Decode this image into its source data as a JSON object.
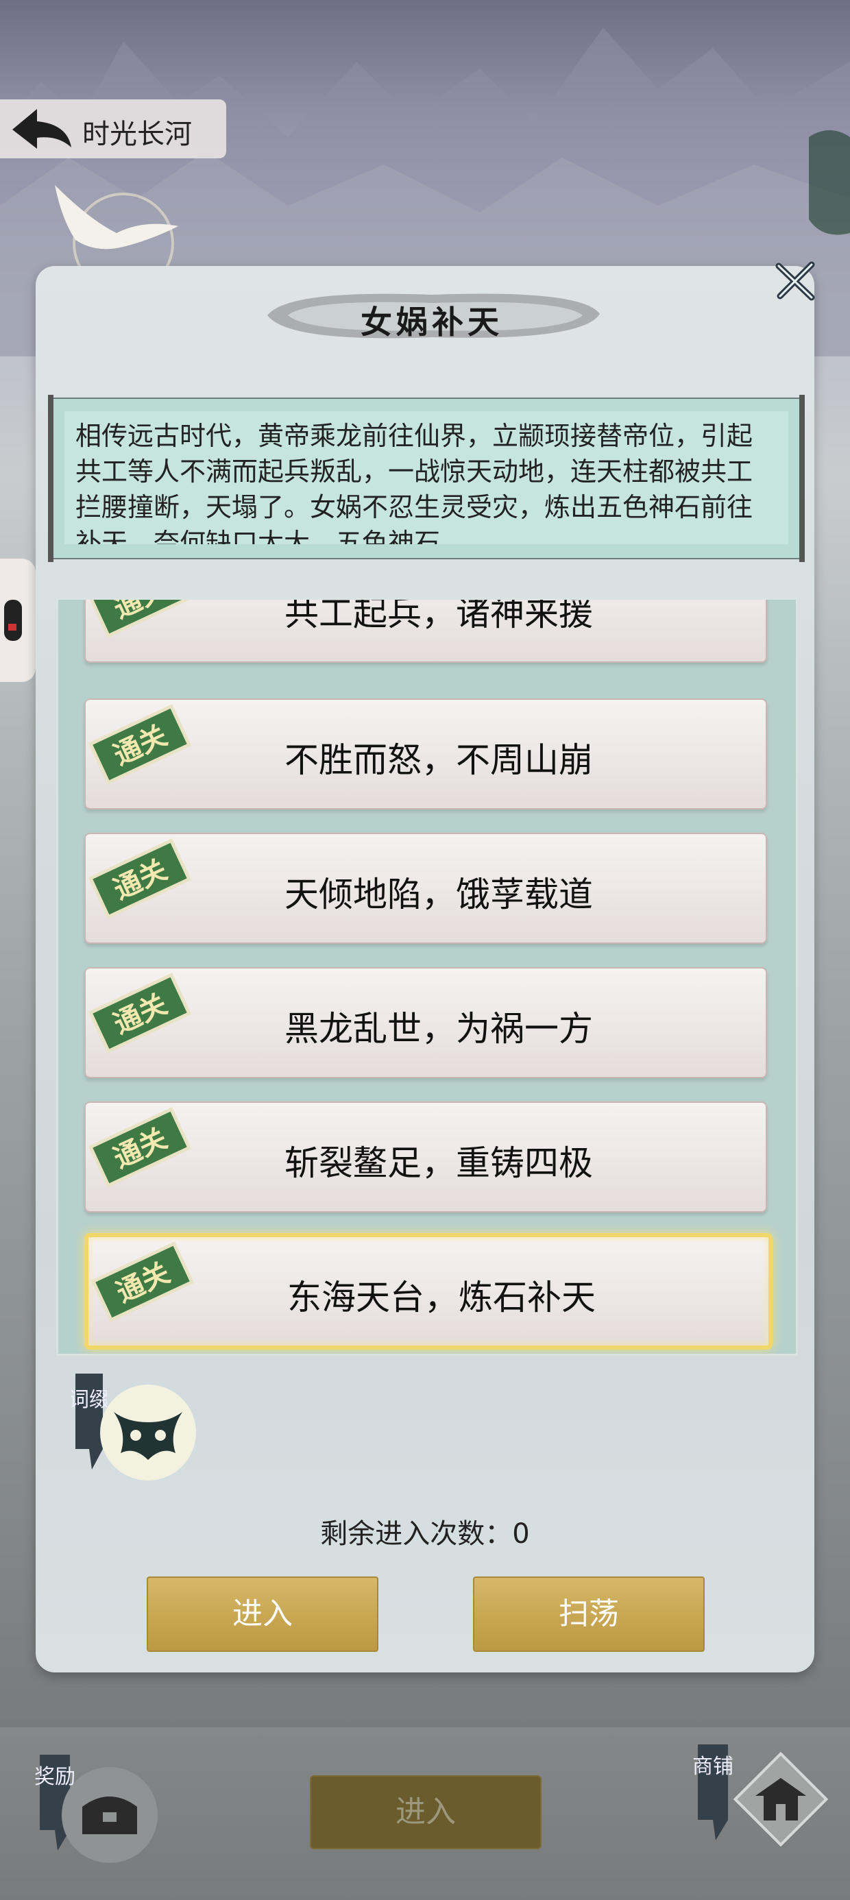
{
  "header": {
    "back_icon": "back-arrow-icon",
    "title": "时光长河"
  },
  "modal": {
    "title": "女娲补天",
    "close_icon": "close-icon",
    "story": "相传远古时代，黄帝乘龙前往仙界，立颛顼接替帝位，引起共工等人不满而起兵叛乱，一战惊天动地，连天柱都被共工拦腰撞断，天塌了。女娲不忍生灵受灾，炼出五色神石前往补天，奈何缺口太大，五色神石",
    "levels": [
      {
        "name": "共工起兵，诸神来援",
        "badge": "通关",
        "active": false
      },
      {
        "name": "不胜而怒，不周山崩",
        "badge": "通关",
        "active": false
      },
      {
        "name": "天倾地陷，饿莩载道",
        "badge": "通关",
        "active": false
      },
      {
        "name": "黑龙乱世，为祸一方",
        "badge": "通关",
        "active": false
      },
      {
        "name": "斩裂鳌足，重铸四极",
        "badge": "通关",
        "active": false
      },
      {
        "name": "东海天台，炼石补天",
        "badge": "通关",
        "active": true
      }
    ],
    "affix": {
      "label": "词缀",
      "icon": "mask-icon"
    },
    "remaining_label": "剩余进入次数：",
    "remaining_count": "0",
    "enter_label": "进入",
    "sweep_label": "扫荡"
  },
  "bottom": {
    "reward_label": "奖励",
    "reward_icon": "treasure-chest-icon",
    "enter_label": "进入",
    "shop_label": "商铺",
    "shop_icon": "shop-pavilion-icon"
  },
  "colors": {
    "button_gold": "#c9a854",
    "active_border": "#f1d769",
    "badge_green": "#3f7a45",
    "scroll_teal": "#c6e6dd"
  }
}
